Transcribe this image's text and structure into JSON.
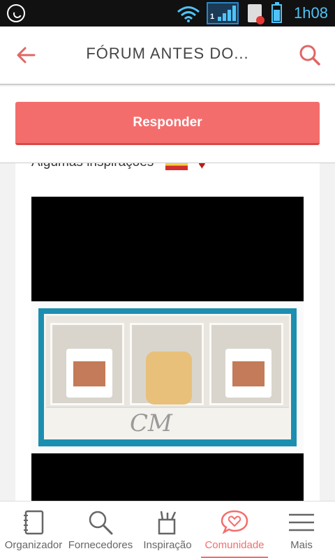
{
  "status_bar": {
    "time": "1h08",
    "signal_badge": "1",
    "icons": [
      "whatsapp-icon",
      "wifi-icon",
      "signal-icon",
      "sim-error-icon",
      "battery-icon"
    ]
  },
  "header": {
    "title": "FÓRUM ANTES DO...",
    "back_icon": "arrow-left-icon",
    "search_icon": "search-icon"
  },
  "actions": {
    "respond_label": "Responder"
  },
  "post": {
    "text": "Algumas inspirações",
    "emoji_icons": [
      "flag-icon",
      "heart-icon"
    ],
    "image_monogram": "CM"
  },
  "bottom_nav": {
    "items": [
      {
        "label": "Organizador",
        "icon": "notebook-icon"
      },
      {
        "label": "Fornecedores",
        "icon": "search-icon"
      },
      {
        "label": "Inspiração",
        "icon": "tools-cup-icon"
      },
      {
        "label": "Comunidade",
        "icon": "heart-chat-icon",
        "active": true
      },
      {
        "label": "Mais",
        "icon": "menu-icon"
      }
    ]
  },
  "colors": {
    "accent": "#f46d6d",
    "status_bar": "#111111",
    "status_text": "#4fc3f7"
  }
}
